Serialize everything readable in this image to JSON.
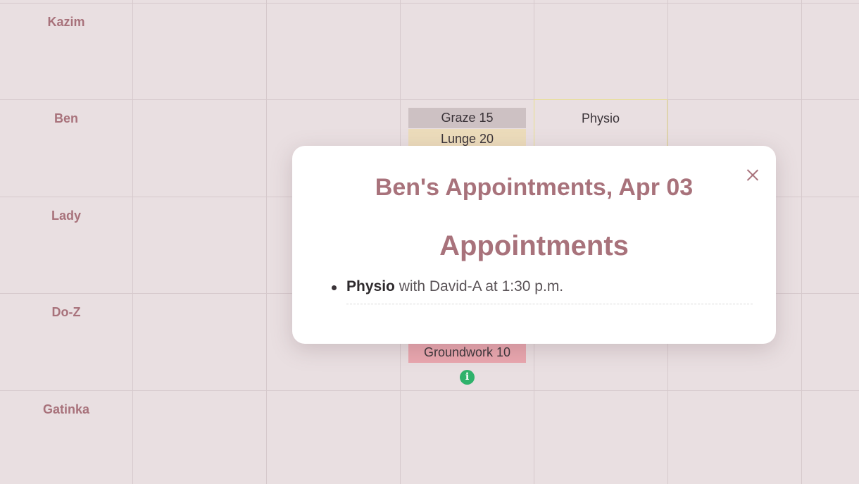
{
  "rows": [
    "Kazim",
    "Ben",
    "Lady",
    "Do-Z",
    "Gatinka"
  ],
  "schedule": {
    "graze": "Graze 15",
    "lunge": "Lunge 20",
    "groundwork": "Groundwork 10",
    "physio": "Physio"
  },
  "icons": {
    "info": "info-icon",
    "close": "close-icon"
  },
  "modal": {
    "title": "Ben's Appointments, Apr 03",
    "section_title": "Appointments",
    "appointments": [
      {
        "name": "Physio",
        "detail": "with David-A at 1:30 p.m."
      }
    ]
  },
  "colors": {
    "accent": "#a8727b",
    "background": "#e9dfe1",
    "graze": "#cdc1c3",
    "lunge": "#ecdcbb",
    "groundwork": "#e9a6ae",
    "info": "#2fb26b"
  }
}
